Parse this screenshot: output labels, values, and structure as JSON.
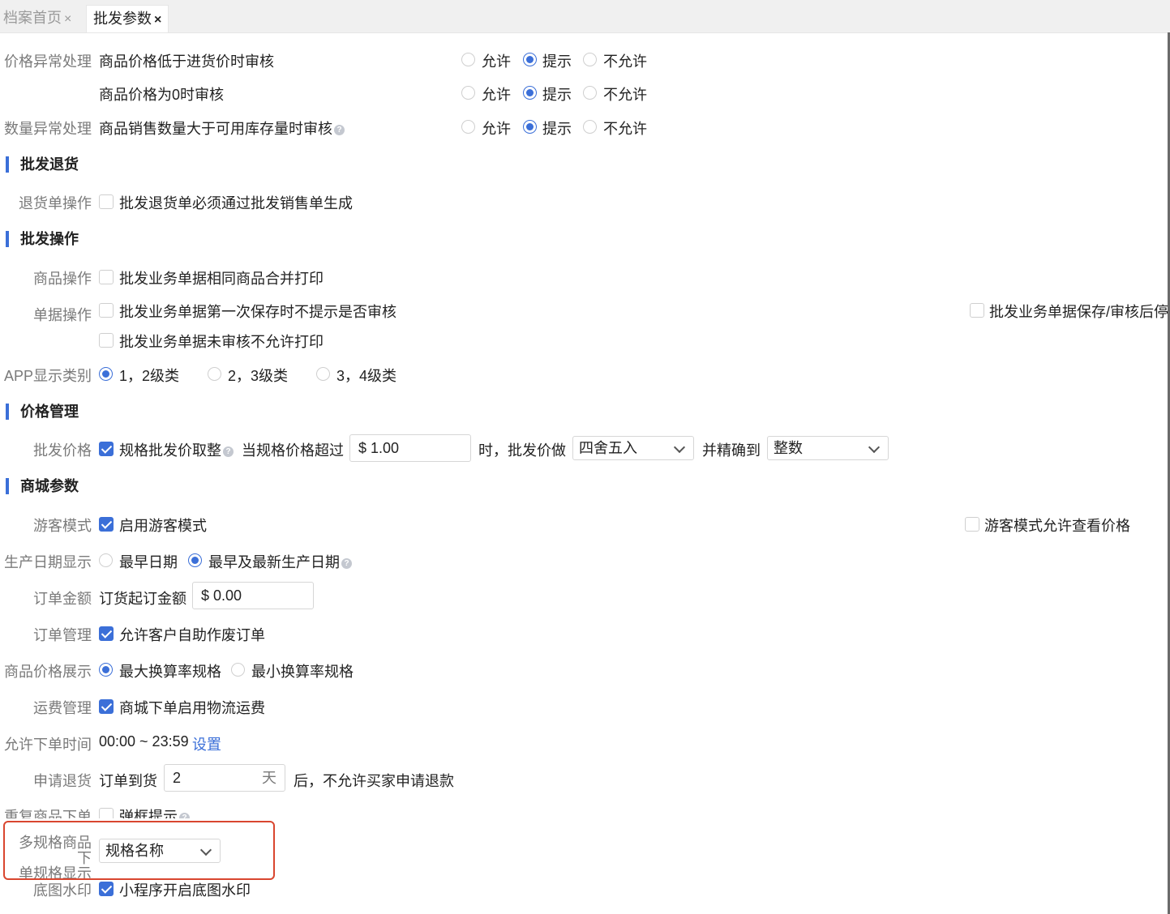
{
  "tabs": [
    {
      "label": "档案首页",
      "close": "×"
    },
    {
      "label": "批发参数",
      "close": "×"
    }
  ],
  "radio_labels": {
    "allow": "允许",
    "prompt": "提示",
    "deny": "不允许"
  },
  "price_abnormal": {
    "label": "价格异常处理",
    "row1": "商品价格低于进货价时审核",
    "row2": "商品价格为0时审核"
  },
  "qty_abnormal": {
    "label": "数量异常处理",
    "row1": "商品销售数量大于可用库存量时审核"
  },
  "sections": {
    "return": "批发退货",
    "operation": "批发操作",
    "price": "价格管理",
    "mall": "商城参数"
  },
  "return_op": {
    "label": "退货单操作",
    "opt": "批发退货单必须通过批发销售单生成"
  },
  "goods_op": {
    "label": "商品操作",
    "opt": "批发业务单据相同商品合并打印"
  },
  "doc_op": {
    "label": "单据操作",
    "opt1": "批发业务单据第一次保存时不提示是否审核",
    "opt2": "批发业务单据未审核不允许打印",
    "opt3": "批发业务单据保存/审核后停留"
  },
  "app_cat": {
    "label": "APP显示类别",
    "opt1": "1，2级类",
    "opt2": "2，3级类",
    "opt3": "3，4级类"
  },
  "wholesale_price": {
    "label": "批发价格",
    "opt": "规格批发价取整",
    "exceed": "当规格价格超过",
    "amount": "$ 1.00",
    "then": "时，批发价做",
    "rounding": "四舍五入",
    "precision_label": "并精确到",
    "precision": "整数"
  },
  "guest": {
    "label": "游客模式",
    "opt": "启用游客模式",
    "opt2": "游客模式允许查看价格"
  },
  "prod_date": {
    "label": "生产日期显示",
    "opt1": "最早日期",
    "opt2": "最早及最新生产日期"
  },
  "order_amount": {
    "label": "订单金额",
    "text": "订货起订金额",
    "value": "$ 0.00"
  },
  "order_mgmt": {
    "label": "订单管理",
    "opt": "允许客户自助作废订单"
  },
  "price_show": {
    "label": "商品价格展示",
    "opt1": "最大换算率规格",
    "opt2": "最小换算率规格"
  },
  "freight": {
    "label": "运费管理",
    "opt": "商城下单启用物流运费"
  },
  "order_time": {
    "label": "允许下单时间",
    "value": "00:00 ~ 23:59",
    "link": "设置"
  },
  "refund": {
    "label": "申请退货",
    "text": "订单到货",
    "days": "2",
    "unit": "天",
    "after": "后，不允许买家申请退款"
  },
  "dup": {
    "label": "重复商品下单",
    "opt": "弹框提示"
  },
  "multi_spec": {
    "label_line1": "多规格商品下",
    "label_line2": "单规格显示",
    "value": "规格名称"
  },
  "watermark": {
    "label": "底图水印",
    "opt": "小程序开启底图水印"
  },
  "help_glyph": "?",
  "colors": {
    "accent": "#3b6fd8",
    "highlight": "#d9462f"
  }
}
